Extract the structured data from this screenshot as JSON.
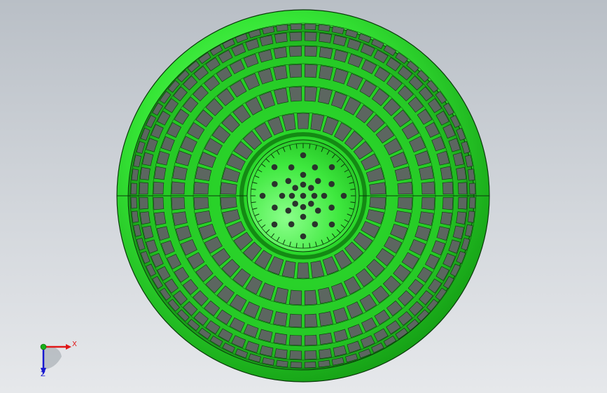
{
  "viewport": {
    "description_free": true
  },
  "model": {
    "part_color": "#2fe02f",
    "part_color_dark": "#148a14",
    "edge_color": "#0a3a0a",
    "hole_color": "#5c6660",
    "center_hole_color": "#2a332c"
  },
  "triad": {
    "x_label": "X",
    "z_label": "Z",
    "x_color": "#e01818",
    "y_color": "#18b018",
    "z_color": "#1818d0"
  }
}
